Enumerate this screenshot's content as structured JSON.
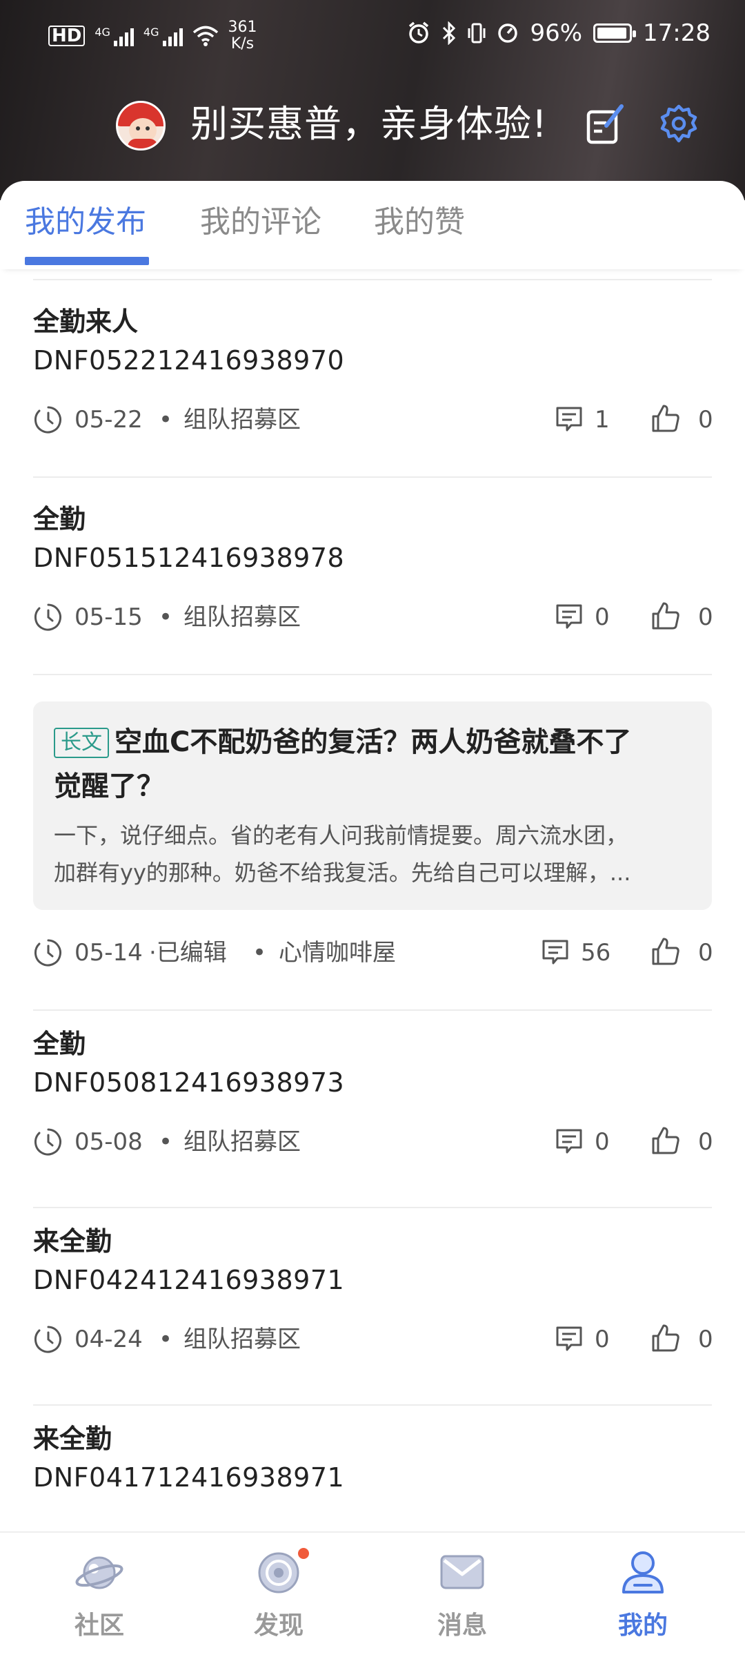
{
  "status_bar": {
    "network_label": "HD",
    "signal1": "4G",
    "signal2": "4G",
    "net_speed_value": "361",
    "net_speed_unit": "K/s",
    "battery_percent": "96%",
    "battery_level": 0.96,
    "time": "17:28"
  },
  "profile": {
    "name": "别买惠普，亲身体验!",
    "icons": {
      "edit": "edit-icon",
      "settings": "gear-icon"
    }
  },
  "tabs": [
    {
      "label": "我的发布",
      "active": true
    },
    {
      "label": "我的评论",
      "active": false
    },
    {
      "label": "我的赞",
      "active": false
    }
  ],
  "posts": [
    {
      "title": "全勤来人",
      "body": "DNF052212416938970",
      "date": "05-22",
      "edited": "",
      "board": "组队招募区",
      "comments": "1",
      "likes": "0"
    },
    {
      "title": "全勤",
      "body": "DNF051512416938978",
      "date": "05-15",
      "edited": "",
      "board": "组队招募区",
      "comments": "0",
      "likes": "0"
    },
    {
      "type": "long",
      "tag": "长文",
      "title_line1": "空血C不配奶爸的复活？两人奶爸就叠不了",
      "title_line2": "觉醒了？",
      "excerpt_line1": "一下，说仔细点。省的老有人问我前情提要。周六流水团，",
      "excerpt_line2": "加群有yy的那种。奶爸不给我复活。先给自己可以理解，...",
      "date": "05-14",
      "edited": "·已编辑",
      "board": "心情咖啡屋",
      "comments": "56",
      "likes": "0"
    },
    {
      "title": "全勤",
      "body": "DNF050812416938973",
      "date": "05-08",
      "edited": "",
      "board": "组队招募区",
      "comments": "0",
      "likes": "0"
    },
    {
      "title": "来全勤",
      "body": "DNF042412416938971",
      "date": "04-24",
      "edited": "",
      "board": "组队招募区",
      "comments": "0",
      "likes": "0"
    },
    {
      "title": "来全勤",
      "body": "DNF041712416938971"
    }
  ],
  "bottom_nav": [
    {
      "label": "社区",
      "icon": "planet-icon",
      "active": false
    },
    {
      "label": "发现",
      "icon": "radar-icon",
      "active": false,
      "badge": true
    },
    {
      "label": "消息",
      "icon": "mail-icon",
      "active": false
    },
    {
      "label": "我的",
      "icon": "user-icon",
      "active": true
    }
  ],
  "colors": {
    "accent": "#4a78e0",
    "badge": "#f05a3a",
    "tag": "#2a9a8a"
  }
}
